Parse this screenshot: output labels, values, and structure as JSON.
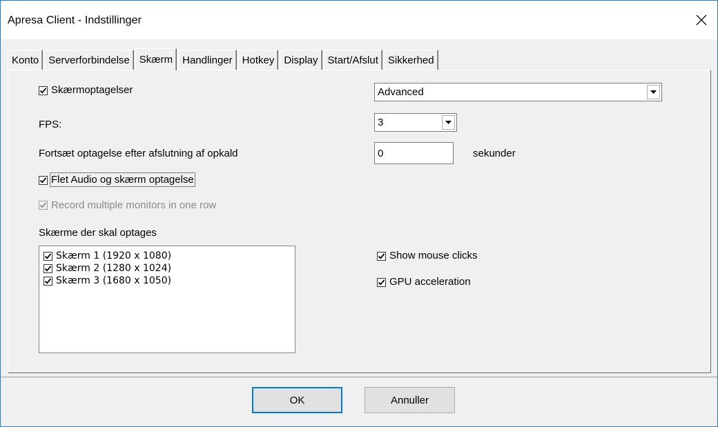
{
  "window": {
    "title": "Apresa Client - Indstillinger"
  },
  "tabs": [
    {
      "label": "Konto"
    },
    {
      "label": "Serverforbindelse"
    },
    {
      "label": "Skærm"
    },
    {
      "label": "Handlinger"
    },
    {
      "label": "Hotkey"
    },
    {
      "label": "Display"
    },
    {
      "label": "Start/Afslut"
    },
    {
      "label": "Sikkerhed"
    }
  ],
  "active_tab": "Skærm",
  "screen": {
    "recording": {
      "label": "Skærmoptagelser",
      "checked": true,
      "mode_value": "Advanced"
    },
    "fps": {
      "label": "FPS:",
      "value": "3"
    },
    "continue": {
      "label": "Fortsæt optagelse efter afslutning af opkald",
      "value": "0",
      "unit": "sekunder"
    },
    "merge": {
      "label": "Flet Audio og skærm optagelse",
      "checked": true
    },
    "multi_monitor": {
      "label": "Record multiple monitors in one row",
      "checked": true,
      "enabled": false
    },
    "monitors_label": "Skærme der skal optages",
    "monitors": [
      {
        "label": "Skærm 1 (1920 x 1080)",
        "checked": true
      },
      {
        "label": "Skærm 2 (1280 x 1024)",
        "checked": true
      },
      {
        "label": "Skærm 3 (1680 x 1050)",
        "checked": true
      }
    ],
    "show_clicks": {
      "label": "Show mouse clicks",
      "checked": true
    },
    "gpu": {
      "label": "GPU acceleration",
      "checked": true
    }
  },
  "buttons": {
    "ok": "OK",
    "cancel": "Annuller"
  },
  "colors": {
    "accent": "#0078d7",
    "window_border": "#2b79c2",
    "face": "#f0f0f0"
  }
}
